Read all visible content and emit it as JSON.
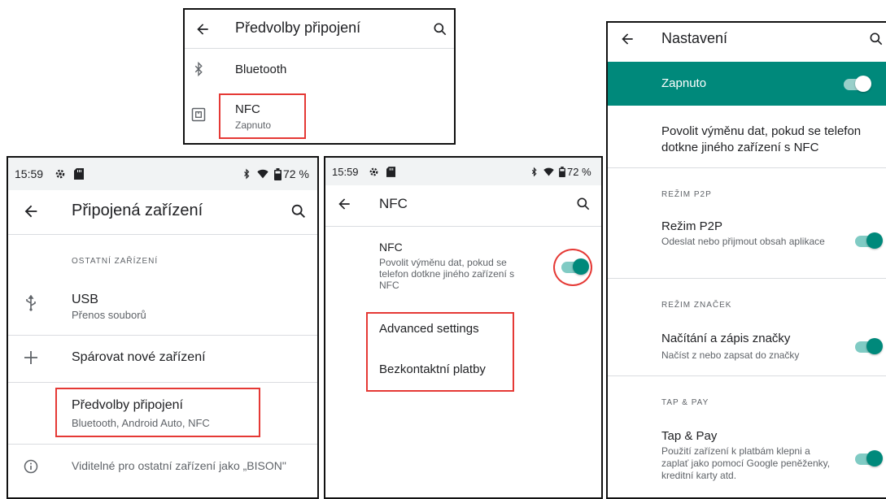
{
  "panel_a": {
    "title": "Předvolby připojení",
    "items": [
      {
        "label": "Bluetooth"
      },
      {
        "label": "NFC",
        "summary": "Zapnuto"
      }
    ]
  },
  "panel_b": {
    "status": {
      "time": "15:59",
      "battery": "72 %"
    },
    "title": "Připojená zařízení",
    "section": "OSTATNÍ ZAŘÍZENÍ",
    "usb": {
      "label": "USB",
      "summary": "Přenos souborů"
    },
    "pair": {
      "label": "Spárovat nové zařízení"
    },
    "prefs": {
      "label": "Předvolby připojení",
      "summary": "Bluetooth, Android Auto, NFC"
    },
    "visible": "Viditelné pro ostatní zařízení jako „BISON\""
  },
  "panel_c": {
    "status": {
      "time": "15:59",
      "battery": "72 %"
    },
    "title": "NFC",
    "nfc": {
      "label": "NFC",
      "summary": "Povolit výměnu dat, pokud se telefon dotkne jiného zařízení s NFC",
      "enabled": true
    },
    "advanced": "Advanced settings",
    "payments": "Bezkontaktní platby"
  },
  "panel_d": {
    "title": "Nastavení",
    "master": {
      "label": "Zapnuto",
      "enabled": true
    },
    "description": "Povolit výměnu dat, pokud se telefon dotkne jiného zařízení s NFC",
    "sections": {
      "p2p": "REŽIM P2P",
      "tag": "REŽIM ZNAČEK",
      "pay": "TAP & PAY"
    },
    "p2p": {
      "label": "Režim P2P",
      "summary": "Odeslat nebo přijmout obsah aplikace",
      "enabled": true
    },
    "tag": {
      "label": "Načítání a zápis značky",
      "summary": "Načíst z nebo zapsat do značky",
      "enabled": true
    },
    "pay": {
      "label": "Tap & Pay",
      "summary": "Použití zařízení k platbám klepni a zaplať jako pomocí Google peněženky, kreditní karty atd.",
      "enabled": true
    }
  },
  "colors": {
    "accent": "#00897b",
    "highlight": "#e53935",
    "statusbar": "#f1f3f4"
  }
}
